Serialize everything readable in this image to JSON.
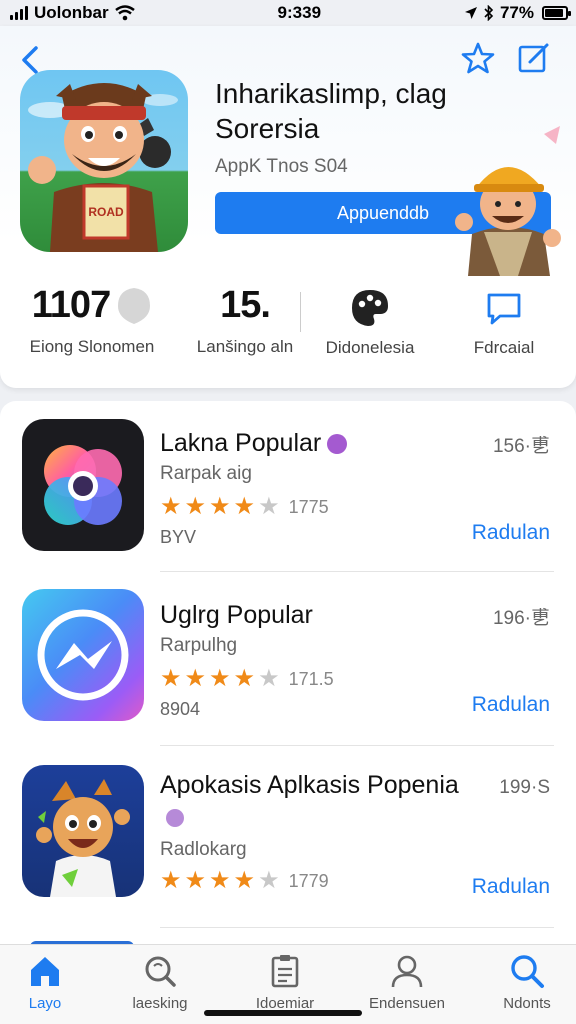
{
  "status_bar": {
    "carrier": "Uolonbar",
    "time": "9:339",
    "battery": "77%"
  },
  "header": {
    "app_title": "Inharikaslimp, clag Sorersia",
    "app_subtitle": "AppK Tnos S04",
    "button_label": "Appuenddb",
    "stats": [
      {
        "value": "1107",
        "label": "Eiong Slonomen"
      },
      {
        "value": "15.",
        "label": "Lanšingo aln"
      },
      {
        "value": "",
        "label": "Didonelesia"
      },
      {
        "value": "",
        "label": "Fdrcaial"
      }
    ]
  },
  "apps": [
    {
      "title": "Lakna Popular",
      "subtitle": "Rarpak aig",
      "rating_stars": 3.5,
      "rating_text": "1775",
      "meta": "BYV",
      "size": "156·乶",
      "action": "Radulan",
      "badge_color": "#a45ad0"
    },
    {
      "title": "Uglrg Popular",
      "subtitle": "Rarpulhg",
      "rating_stars": 4,
      "rating_text": "171.5",
      "meta": "8904",
      "size": "196·乶",
      "action": "Radulan",
      "badge_color": ""
    },
    {
      "title": "Apokasis Aplkasis Popenia",
      "subtitle": "Radlokarg",
      "rating_stars": 3.5,
      "rating_text": "1779",
      "meta": "",
      "size": "199·S",
      "action": "Radulan",
      "badge_color": "#b68ad8"
    }
  ],
  "tabs": [
    {
      "label": "Layo",
      "active": true
    },
    {
      "label": "laesking",
      "active": false
    },
    {
      "label": "Idoemiar",
      "active": false
    },
    {
      "label": "Endensuen",
      "active": false
    },
    {
      "label": "Ndonts",
      "active": false
    }
  ],
  "colors": {
    "accent": "#1e7cf0",
    "star": "#f08a18"
  }
}
